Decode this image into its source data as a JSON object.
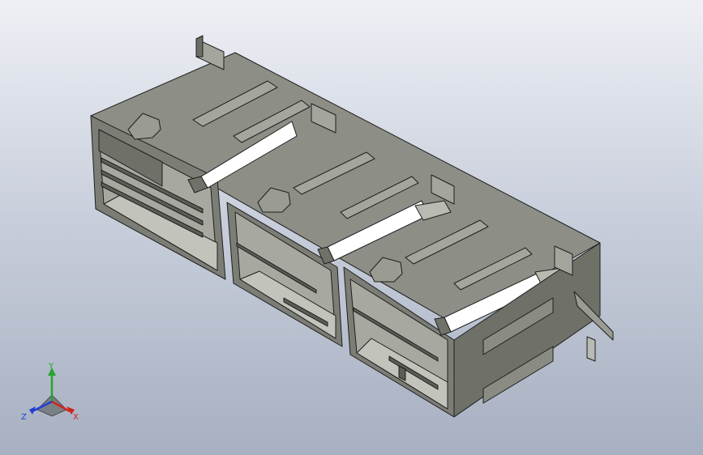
{
  "viewport": {
    "background_top": "#eef0f5",
    "background_bottom": "#a7b0c1"
  },
  "model": {
    "body_color": "#83857c",
    "highlight_color": "#ffffff",
    "edge_color": "#1e1e1e",
    "housings": 3
  },
  "triad": {
    "x_label": "X",
    "y_label": "Y",
    "z_label": "Z",
    "x_color": "#d0241b",
    "y_color": "#27a42f",
    "z_color": "#1f3fd6"
  }
}
